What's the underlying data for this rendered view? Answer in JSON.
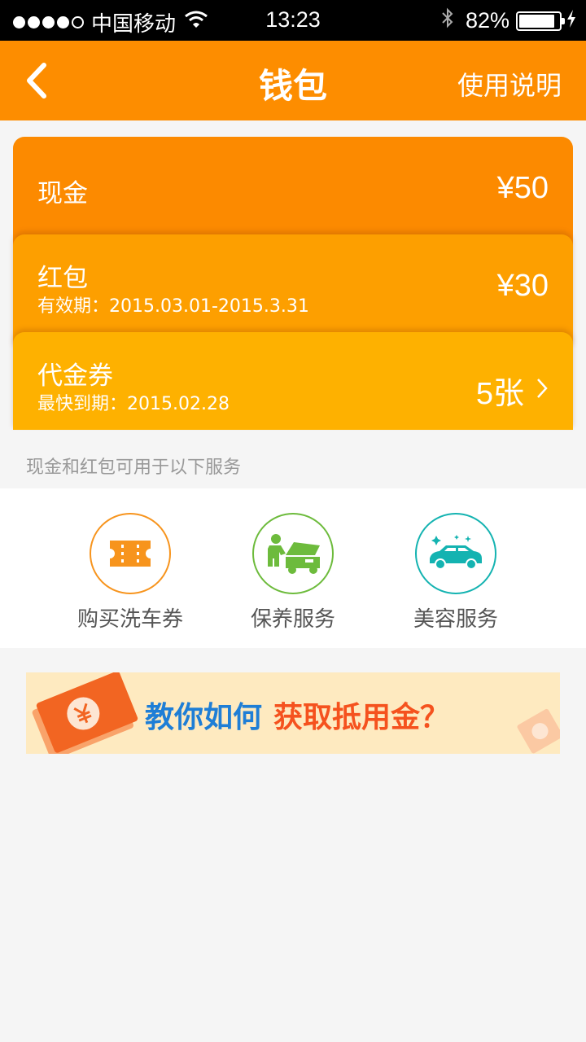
{
  "status_bar": {
    "carrier": "中国移动",
    "time": "13:23",
    "battery": "82%",
    "signal_bars": 4
  },
  "nav": {
    "title": "钱包",
    "right_action": "使用说明",
    "back_icon": "chevron-left-icon"
  },
  "wallet": {
    "cash": {
      "title": "现金",
      "amount": "¥50"
    },
    "red_packet": {
      "title": "红包",
      "validity": "有效期：2015.03.01-2015.3.31",
      "amount": "¥30"
    },
    "voucher": {
      "title": "代金券",
      "expiry": "最快到期：2015.02.28",
      "count": "5张"
    }
  },
  "hint": "现金和红包可用于以下服务",
  "services": [
    {
      "label": "购买洗车券",
      "icon": "ticket-icon",
      "color": "#f7941d"
    },
    {
      "label": "保养服务",
      "icon": "mechanic-icon",
      "color": "#6dbb3c"
    },
    {
      "label": "美容服务",
      "icon": "car-sparkle-icon",
      "color": "#14b3b1"
    }
  ],
  "banner": {
    "part1": "教你如何",
    "part2": "获取抵用金？"
  },
  "colors": {
    "accent": "#fd8d00",
    "card_cash": "#fc8a00",
    "card_packet": "#fd9f00",
    "card_voucher": "#feb100"
  }
}
